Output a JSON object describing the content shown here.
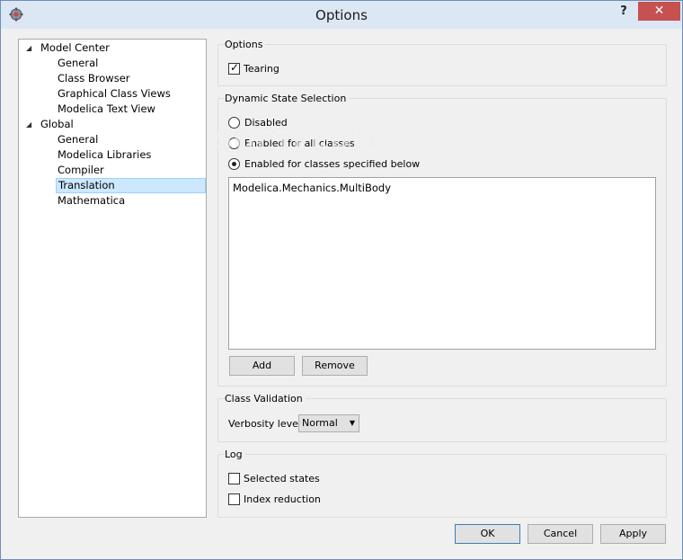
{
  "window": {
    "title": "Options",
    "help_label": "?",
    "close_label": "✕"
  },
  "tree": {
    "items": [
      {
        "label": "Model Center",
        "level": 0,
        "expanded": true
      },
      {
        "label": "General",
        "level": 1
      },
      {
        "label": "Class Browser",
        "level": 1
      },
      {
        "label": "Graphical Class Views",
        "level": 1
      },
      {
        "label": "Modelica Text View",
        "level": 1
      },
      {
        "label": "Global",
        "level": 0,
        "expanded": true
      },
      {
        "label": "General",
        "level": 1
      },
      {
        "label": "Modelica Libraries",
        "level": 1
      },
      {
        "label": "Compiler",
        "level": 1
      },
      {
        "label": "Translation",
        "level": 1,
        "selected": true
      },
      {
        "label": "Mathematica",
        "level": 1
      }
    ],
    "expand_glyph": "◢"
  },
  "options_group": {
    "title": "Options",
    "tearing_label": "Tearing",
    "tearing_checked": true
  },
  "dynamic_state": {
    "title": "Dynamic State Selection",
    "radio_disabled": "Disabled",
    "radio_all": "Enabled for all classes",
    "radio_specified": "Enabled for classes specified below",
    "selected": "specified",
    "list_items": [
      "Modelica.Mechanics.MultiBody"
    ],
    "add_label": "Add",
    "remove_label": "Remove"
  },
  "class_validation": {
    "title": "Class Validation",
    "verbosity_label": "Verbosity level:",
    "verbosity_value": "Normal"
  },
  "log": {
    "title": "Log",
    "selected_states_label": "Selected states",
    "index_reduction_label": "Index reduction"
  },
  "footer": {
    "ok_label": "OK",
    "cancel_label": "Cancel",
    "apply_label": "Apply"
  },
  "watermark": "SOFTPEDIA"
}
